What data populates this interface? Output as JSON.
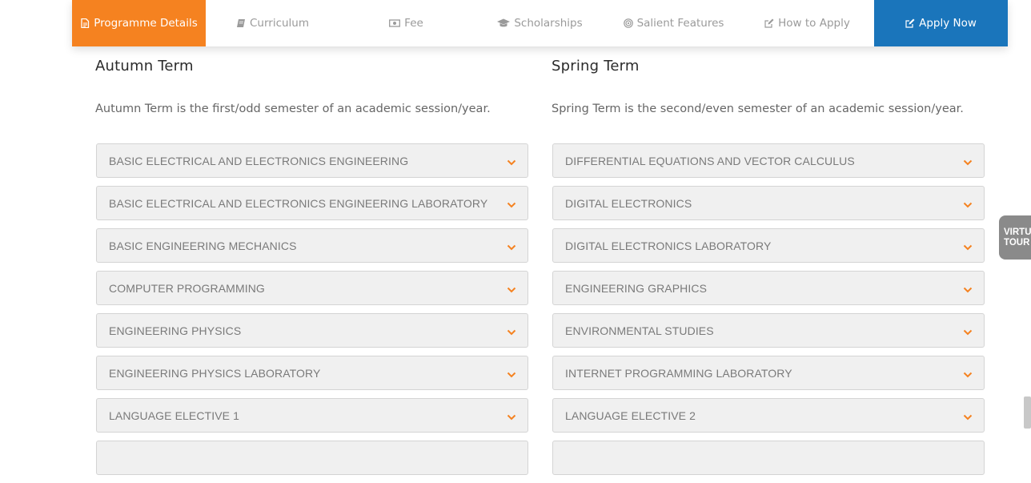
{
  "tabs": [
    {
      "label": "Programme Details",
      "icon": "document-icon",
      "active": true
    },
    {
      "label": "Curriculum",
      "icon": "book-icon"
    },
    {
      "label": "Fee",
      "icon": "money-icon"
    },
    {
      "label": "Scholarships",
      "icon": "graduation-cap-icon"
    },
    {
      "label": "Salient Features",
      "icon": "target-icon"
    },
    {
      "label": "How to Apply",
      "icon": "edit-icon"
    },
    {
      "label": "Apply Now",
      "icon": "edit-icon"
    }
  ],
  "colors": {
    "active_tab": "#f58220",
    "apply_tab": "#1a75bb",
    "chevron": "#f58220"
  },
  "autumn": {
    "title": "Autumn Term",
    "description": "Autumn Term is the first/odd semester of an academic session/year.",
    "courses": [
      "BASIC ELECTRICAL AND ELECTRONICS ENGINEERING",
      "BASIC ELECTRICAL AND ELECTRONICS ENGINEERING LABORATORY",
      "BASIC ENGINEERING MECHANICS",
      "COMPUTER PROGRAMMING",
      "ENGINEERING PHYSICS",
      "ENGINEERING PHYSICS LABORATORY",
      "LANGUAGE ELECTIVE 1"
    ]
  },
  "spring": {
    "title": "Spring Term",
    "description": "Spring Term is the second/even semester of an academic session/year.",
    "courses": [
      "DIFFERENTIAL EQUATIONS AND VECTOR CALCULUS",
      "DIGITAL ELECTRONICS",
      "DIGITAL ELECTRONICS LABORATORY",
      "ENGINEERING GRAPHICS",
      "ENVIRONMENTAL STUDIES",
      "INTERNET PROGRAMMING LABORATORY",
      "LANGUAGE ELECTIVE 2"
    ]
  },
  "virtual_tour": {
    "line1": "VIRTUAL",
    "line2": "TOUR"
  }
}
